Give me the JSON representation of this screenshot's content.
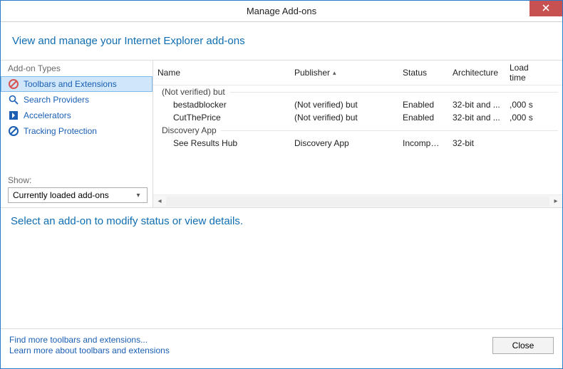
{
  "window": {
    "title": "Manage Add-ons"
  },
  "header": {
    "text": "View and manage your Internet Explorer add-ons"
  },
  "sidebar": {
    "types_label": "Add-on Types",
    "items": [
      {
        "label": "Toolbars and Extensions"
      },
      {
        "label": "Search Providers"
      },
      {
        "label": "Accelerators"
      },
      {
        "label": "Tracking Protection"
      }
    ],
    "show_label": "Show:",
    "dropdown_value": "Currently loaded add-ons"
  },
  "columns": {
    "name": "Name",
    "publisher": "Publisher",
    "status": "Status",
    "architecture": "Architecture",
    "load_time": "Load time"
  },
  "groups": [
    {
      "label": "(Not verified) but",
      "rows": [
        {
          "name": "bestadblocker",
          "publisher": "(Not verified) but",
          "status": "Enabled",
          "arch": "32-bit and ...",
          "load": ",000 s"
        },
        {
          "name": "CutThePrice",
          "publisher": "(Not verified) but",
          "status": "Enabled",
          "arch": "32-bit and ...",
          "load": ",000 s"
        }
      ]
    },
    {
      "label": "Discovery App",
      "rows": [
        {
          "name": "See Results Hub",
          "publisher": "Discovery App",
          "status": "Incompatible",
          "arch": "32-bit",
          "load": ""
        }
      ]
    }
  ],
  "detail": {
    "prompt": "Select an add-on to modify status or view details."
  },
  "footer": {
    "link_find": "Find more toolbars and extensions...",
    "link_learn": "Learn more about toolbars and extensions",
    "close": "Close"
  }
}
